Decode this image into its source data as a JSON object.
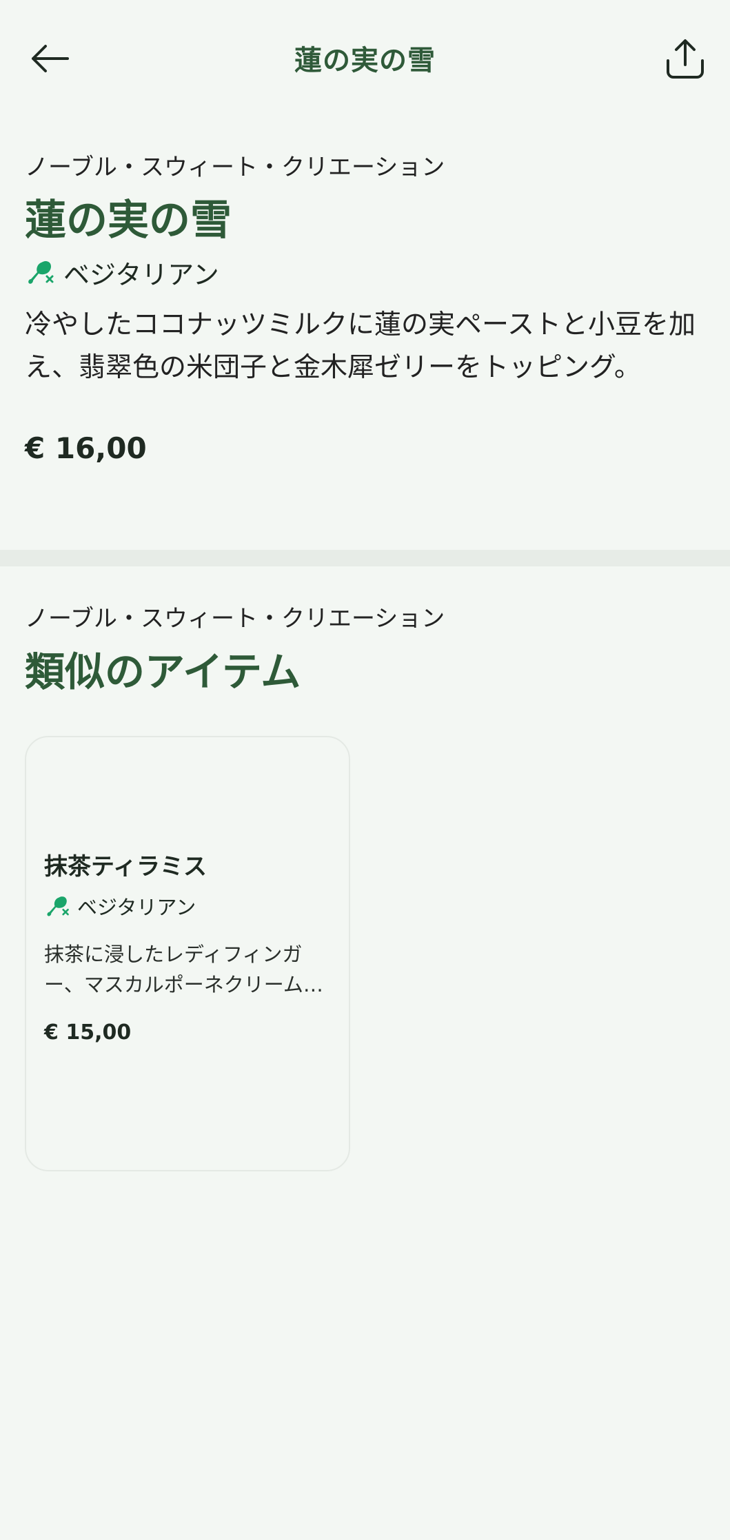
{
  "header": {
    "title": "蓮の実の雪",
    "back_icon": "arrow-left-icon",
    "share_icon": "share-icon"
  },
  "product": {
    "category": "ノーブル・スウィート・クリエーション",
    "name": "蓮の実の雪",
    "diet_label": "ベジタリアン",
    "diet_icon": "vegetarian-drumstick-crossed-icon",
    "description": "冷やしたココナッツミルクに蓮の実ペーストと小豆を加え、翡翠色の米団子と金木犀ゼリーをトッピング。",
    "price": "€ 16,00"
  },
  "similar": {
    "category": "ノーブル・スウィート・クリエーション",
    "title": "類似のアイテム",
    "items": [
      {
        "name": "抹茶ティラミス",
        "diet_label": "ベジタリアン",
        "description": "抹茶に浸したレディフィンガー、マスカルポーネクリーム…",
        "price": "€ 15,00"
      }
    ]
  },
  "colors": {
    "background": "#f3f7f3",
    "accent_green": "#2e5a38",
    "icon_green": "#1aa56a",
    "divider": "#e7ece7"
  }
}
